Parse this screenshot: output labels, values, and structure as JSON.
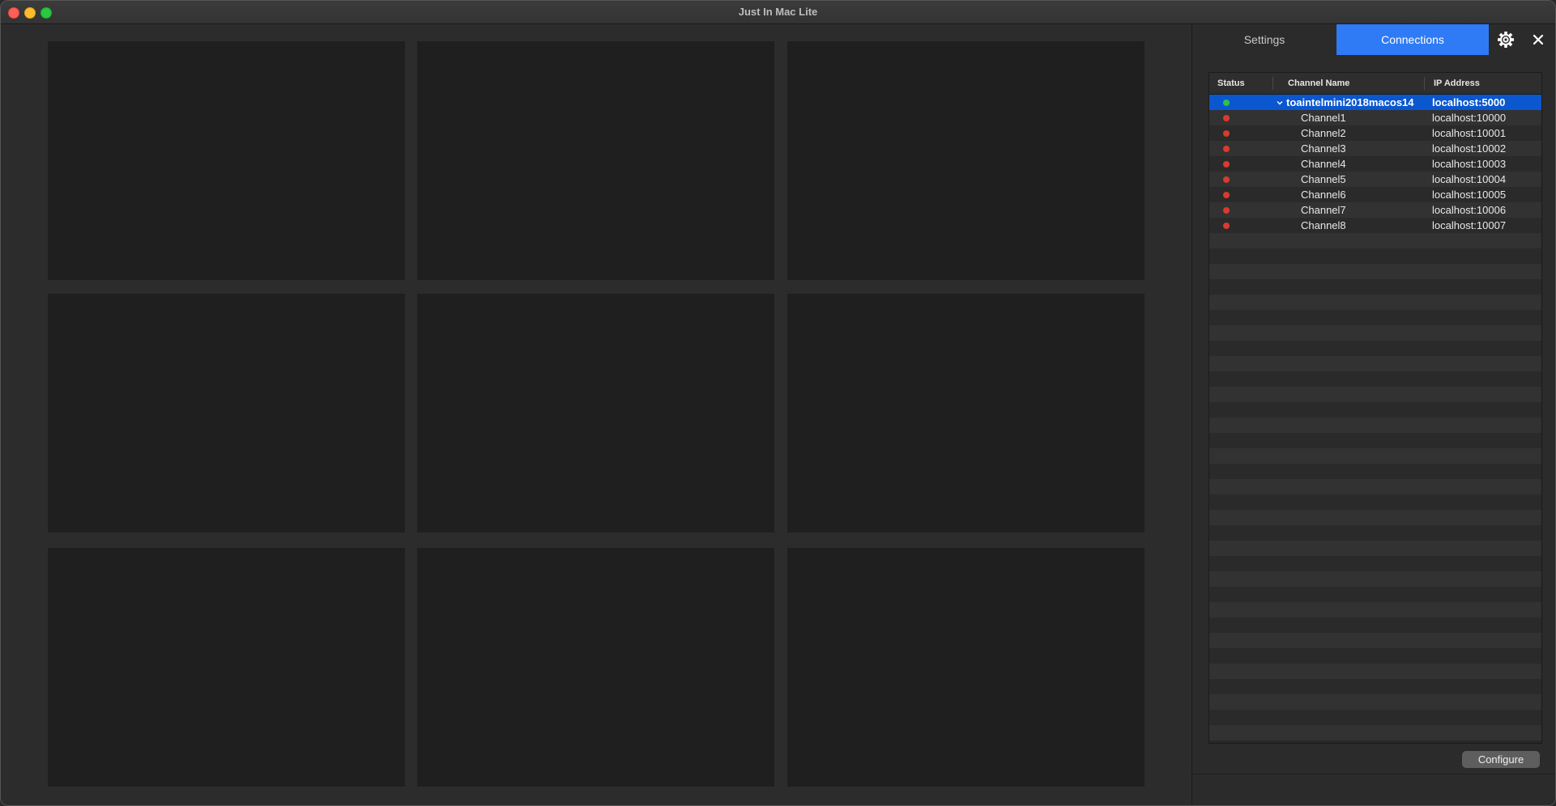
{
  "window": {
    "title": "Just In Mac Lite"
  },
  "video_grid": {
    "rows": 3,
    "cols": 3
  },
  "side_panel": {
    "tabs": [
      {
        "label": "Settings",
        "active": false
      },
      {
        "label": "Connections",
        "active": true
      }
    ],
    "gear_icon": "gear-icon",
    "close_icon": "close-icon"
  },
  "connections_table": {
    "headers": {
      "status": "Status",
      "channel_name": "Channel Name",
      "ip_address": "IP Address"
    },
    "rows": [
      {
        "status": "green",
        "name": "toaintelmini2018macos14",
        "ip": "localhost:5000",
        "expanded": true,
        "selected": true,
        "level": 0
      },
      {
        "status": "red",
        "name": "Channel1",
        "ip": "localhost:10000",
        "level": 1
      },
      {
        "status": "red",
        "name": "Channel2",
        "ip": "localhost:10001",
        "level": 1
      },
      {
        "status": "red",
        "name": "Channel3",
        "ip": "localhost:10002",
        "level": 1
      },
      {
        "status": "red",
        "name": "Channel4",
        "ip": "localhost:10003",
        "level": 1
      },
      {
        "status": "red",
        "name": "Channel5",
        "ip": "localhost:10004",
        "level": 1
      },
      {
        "status": "red",
        "name": "Channel6",
        "ip": "localhost:10005",
        "level": 1
      },
      {
        "status": "red",
        "name": "Channel7",
        "ip": "localhost:10006",
        "level": 1
      },
      {
        "status": "red",
        "name": "Channel8",
        "ip": "localhost:10007",
        "level": 1
      }
    ]
  },
  "configure_button": {
    "label": "Configure"
  },
  "colors": {
    "accent": "#2f7bf5",
    "selection": "#0a57d0",
    "status_green": "#30c04a",
    "status_red": "#d93a2f"
  }
}
